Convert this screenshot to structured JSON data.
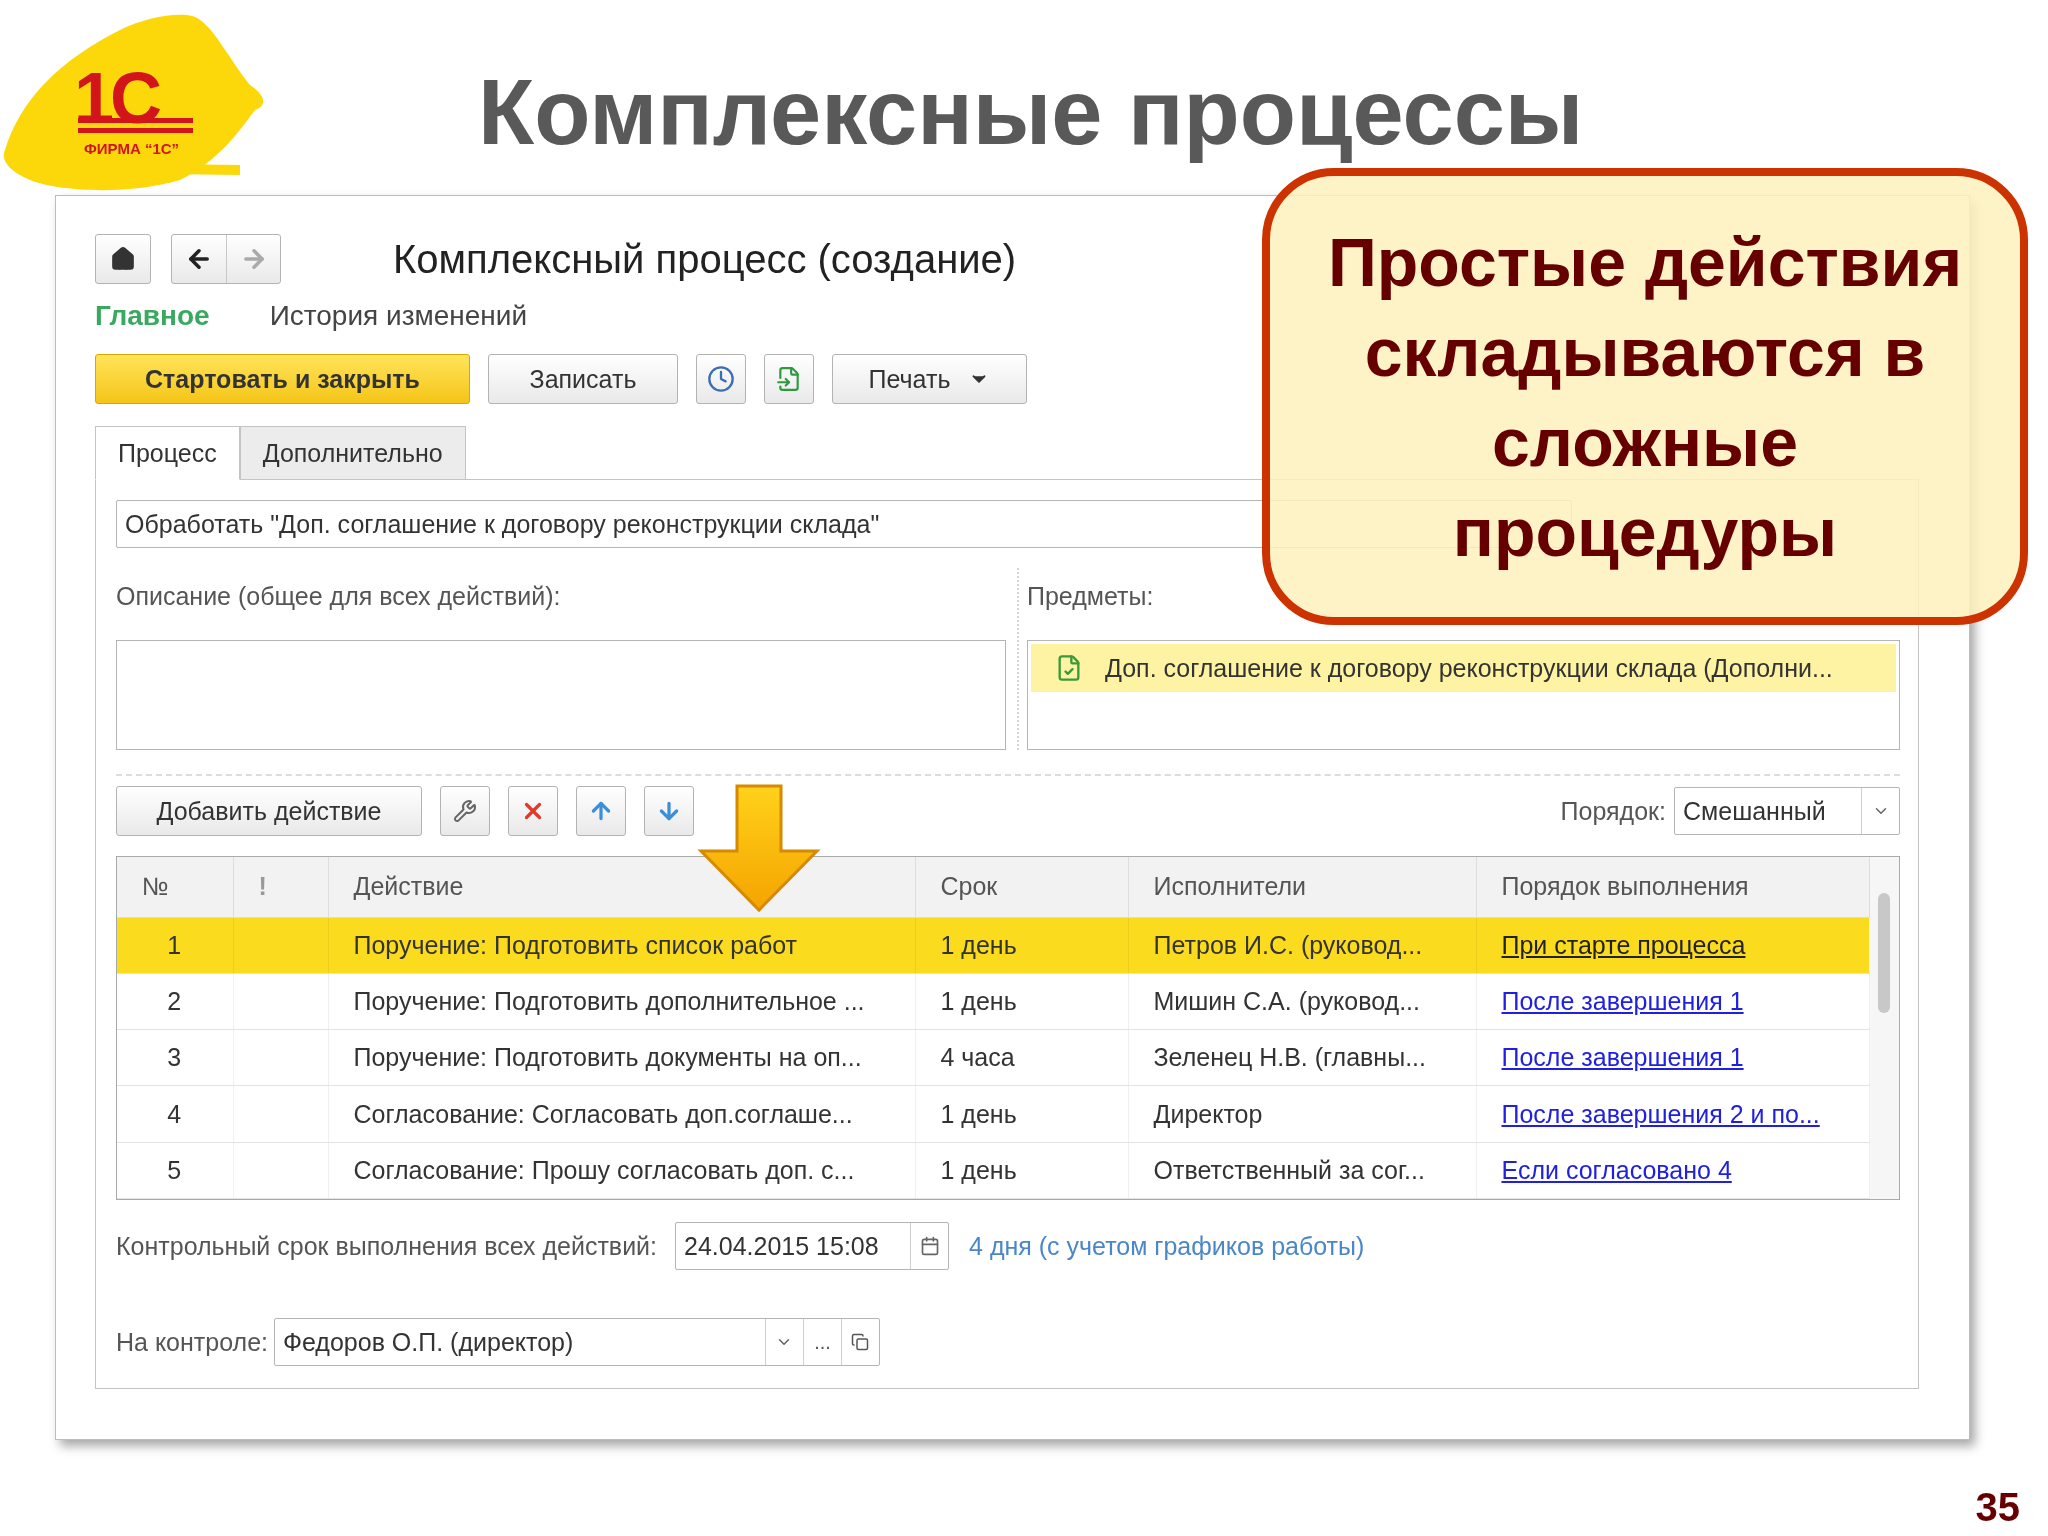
{
  "slide": {
    "title": "Комплексные процессы",
    "logo_mark": "1С",
    "logo_caption": "ФИРМА “1С”",
    "page_number": "35"
  },
  "window": {
    "title": "Комплексный процесс (создание)",
    "sections": [
      {
        "label": "Главное",
        "selected": true
      },
      {
        "label": "История изменений",
        "selected": false
      }
    ],
    "toolbar": {
      "start_button": "Стартовать и закрыть",
      "save_button": "Записать",
      "print_button": "Печать"
    },
    "tabs": [
      {
        "label": "Процесс",
        "selected": true
      },
      {
        "label": "Дополнительно",
        "selected": false
      }
    ],
    "subject_field": {
      "value": "Обработать \"Доп. соглашение к договору реконструкции склада\""
    },
    "description": {
      "label": "Описание (общее для всех действий):"
    },
    "subjects": {
      "label": "Предметы:",
      "items": [
        {
          "text": "Доп. соглашение к договору реконструкции склада (Дополни...",
          "selected": true
        }
      ]
    },
    "actions_toolbar": {
      "add_button": "Добавить действие",
      "order_label": "Порядок:",
      "order_value": "Смешанный"
    },
    "table": {
      "columns": [
        "№",
        "!",
        "Действие",
        "Срок",
        "Исполнители",
        "Порядок выполнения"
      ],
      "rows": [
        {
          "number": "1",
          "action": "Поручение: Подготовить список работ",
          "term": "1 день",
          "performers": "Петров И.С. (руковод...",
          "order": "При старте процесса",
          "selected": true
        },
        {
          "number": "2",
          "action": "Поручение: Подготовить дополнительное ...",
          "term": "1 день",
          "performers": "Мишин С.А. (руковод...",
          "order": "После завершения 1",
          "selected": false
        },
        {
          "number": "3",
          "action": "Поручение: Подготовить документы на оп...",
          "term": "4 часа",
          "performers": "Зеленец Н.В. (главны...",
          "order": "После завершения 1",
          "selected": false
        },
        {
          "number": "4",
          "action": "Согласование: Согласовать доп.соглаше...",
          "term": "1 день",
          "performers": "Директор",
          "order": "После завершения 2 и по...",
          "selected": false
        },
        {
          "number": "5",
          "action": "Согласование: Прошу согласовать доп. с...",
          "term": "1 день",
          "performers": "Ответственный за сог...",
          "order": "Если согласовано 4",
          "selected": false
        }
      ]
    },
    "deadline": {
      "label": "Контрольный срок выполнения всех действий:",
      "value": "24.04.2015 15:08",
      "note": "4 дня (с учетом графиков работы)"
    },
    "controller": {
      "label": "На контроле:",
      "value": "Федоров О.П. (директор)",
      "more_button": "..."
    }
  },
  "callout": {
    "text": "Простые действия складываются в сложные процедуры"
  }
}
